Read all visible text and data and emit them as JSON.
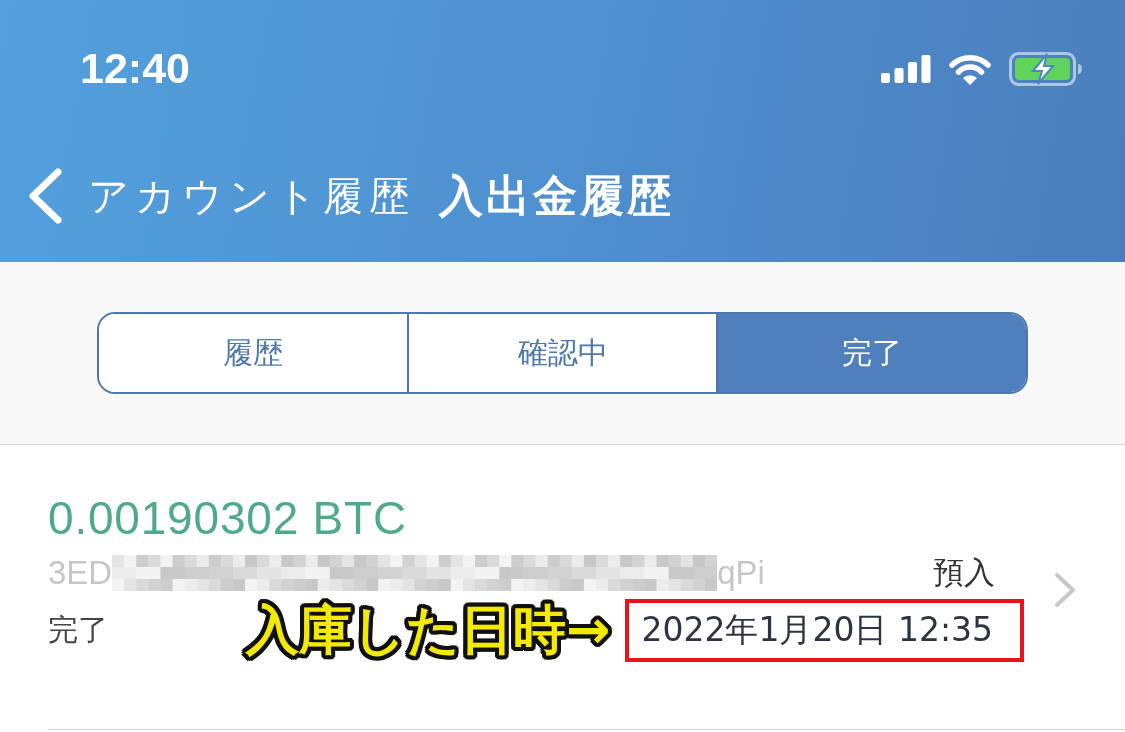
{
  "status_bar": {
    "time": "12:40"
  },
  "nav_bar": {
    "back_label": "アカウント履歴",
    "title": "入出金履歴"
  },
  "segments": [
    {
      "label": "履歴",
      "selected": false
    },
    {
      "label": "確認中",
      "selected": false
    },
    {
      "label": "完了",
      "selected": true
    }
  ],
  "transactions": [
    {
      "amount": "0.00190302 BTC",
      "address_prefix": "3ED",
      "address_suffix": "qPi",
      "type": "預入",
      "status": "完了",
      "callout": "入庫した日時→",
      "datetime": "2022年1月20日 12:35",
      "highlighted": true
    }
  ]
}
